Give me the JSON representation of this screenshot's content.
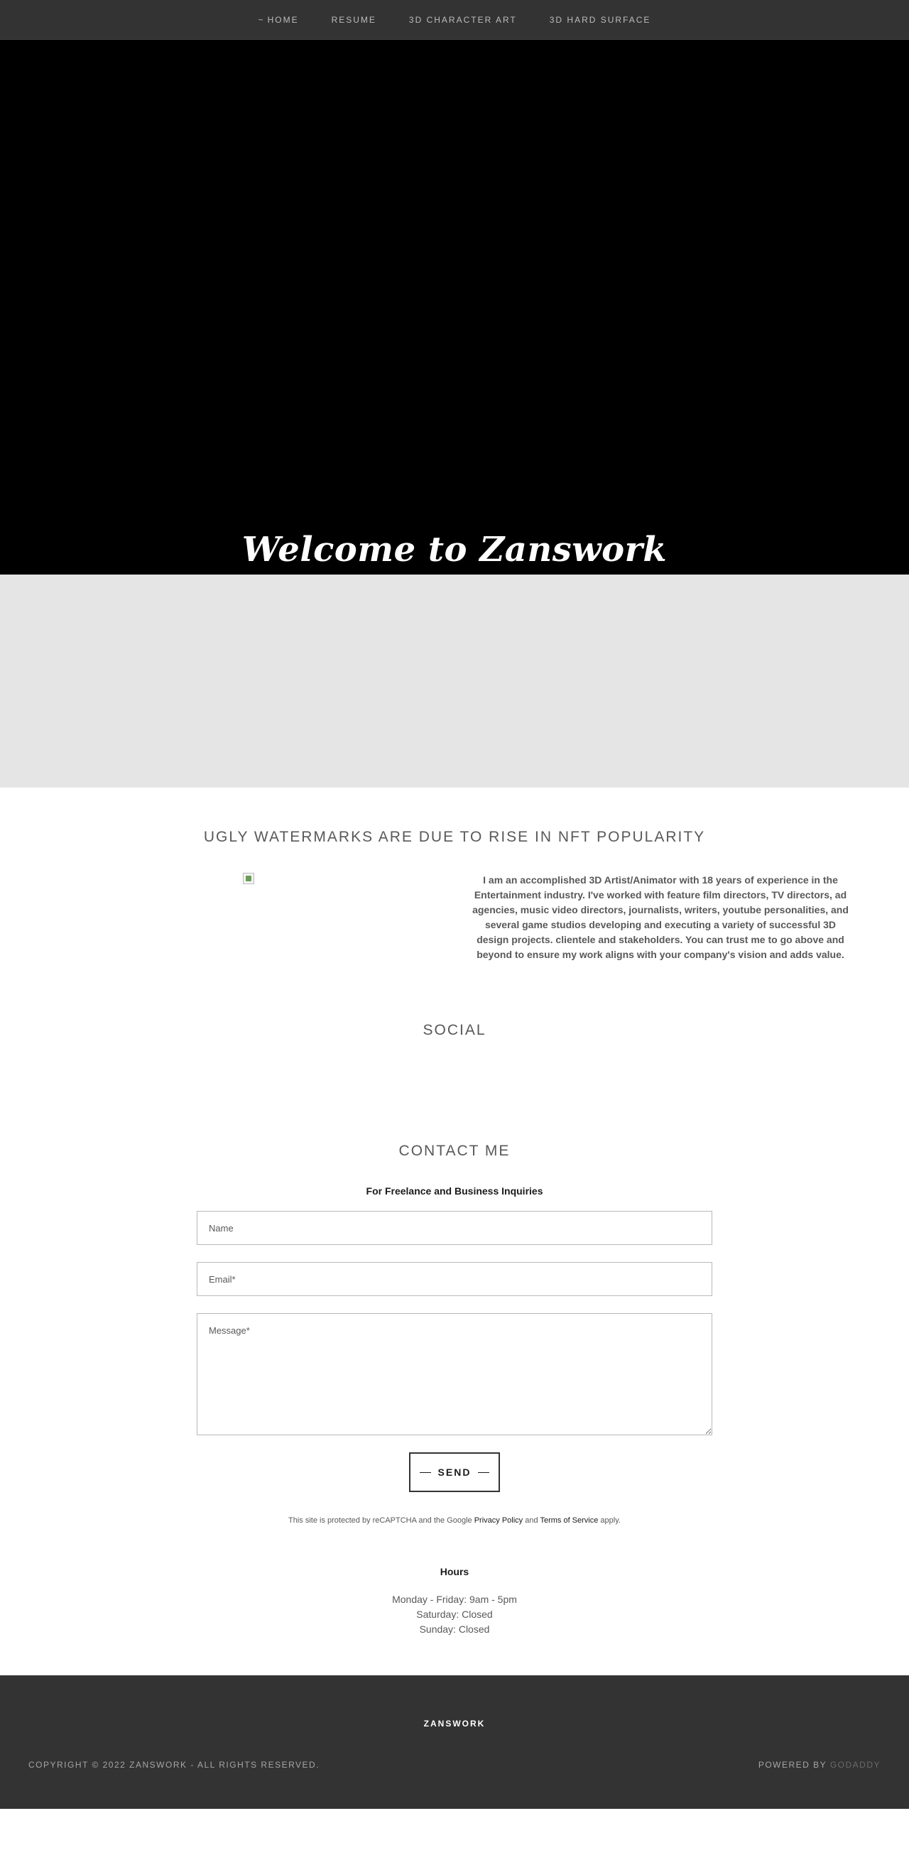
{
  "nav": {
    "items": [
      {
        "label": "HOME",
        "prefix": "~"
      },
      {
        "label": "RESUME"
      },
      {
        "label": "3D CHARACTER ART"
      },
      {
        "label": "3D HARD SURFACE"
      }
    ]
  },
  "hero": {
    "title": "Welcome to Zanswork"
  },
  "about": {
    "heading": "UGLY WATERMARKS ARE DUE TO RISE IN NFT POPULARITY",
    "text": "I am an accomplished 3D Artist/Animator with 18 years of experience in the Entertainment industry. I've worked with feature film directors, TV directors, ad agencies, music video directors, journalists, writers, youtube personalities, and several game studios developing and executing a variety of successful 3D design projects. clientele and stakeholders. You can trust me to go above and beyond to ensure my work aligns with your company's vision and adds value."
  },
  "social": {
    "heading": "SOCIAL"
  },
  "contact": {
    "heading": "CONTACT ME",
    "subheading": "For Freelance and Business Inquiries",
    "name_placeholder": "Name",
    "email_placeholder": "Email*",
    "message_placeholder": "Message*",
    "send_label": "SEND",
    "recaptcha_prefix": "This site is protected by reCAPTCHA and the Google ",
    "privacy_label": "Privacy Policy",
    "and_label": " and ",
    "terms_label": "Terms of Service",
    "apply_label": " apply."
  },
  "hours": {
    "title": "Hours",
    "lines": [
      "Monday - Friday: 9am - 5pm",
      "Saturday: Closed",
      "Sunday: Closed"
    ]
  },
  "footer": {
    "brand": "ZANSWORK",
    "copyright": "COPYRIGHT © 2022 ZANSWORK - ALL RIGHTS RESERVED.",
    "powered_prefix": "POWERED BY ",
    "powered_link": "GODADDY"
  }
}
